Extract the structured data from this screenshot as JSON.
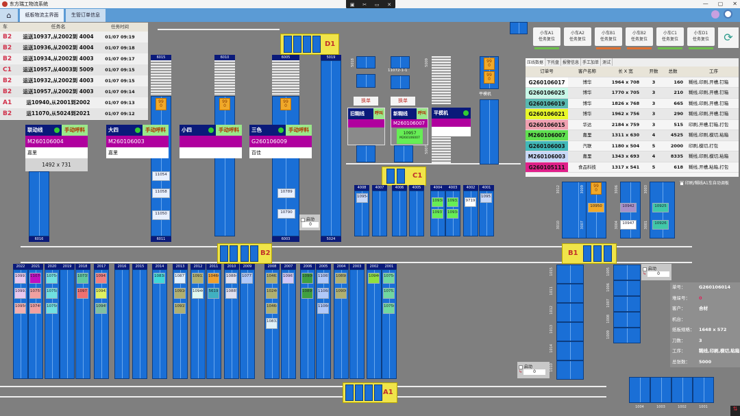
{
  "window": {
    "title": "东方瑞工物流系统",
    "controls": [
      "—",
      "▢",
      "✕"
    ]
  },
  "capture_bar": [
    "▣",
    "✂",
    "▭",
    "✕"
  ],
  "tabs": [
    {
      "label": "⌂"
    },
    {
      "label": "纸板物流主界面"
    },
    {
      "label": "生管订单信息"
    }
  ],
  "tasks": {
    "headers": [
      "车",
      "任务名",
      "任务时间"
    ],
    "rows": [
      {
        "car": "B2",
        "name": "运送10937,从2002到 4004",
        "time": "01/07 09:19"
      },
      {
        "car": "B2",
        "name": "运送10936,从2002到 4004",
        "time": "01/07 09:18"
      },
      {
        "car": "B2",
        "name": "运送10934,从2002到 4003",
        "time": "01/07 09:17"
      },
      {
        "car": "C1",
        "name": "运送10957,从4003到 5009",
        "time": "01/07 09:15"
      },
      {
        "car": "B2",
        "name": "运送10932,从2002到 4003",
        "time": "01/07 09:15"
      },
      {
        "car": "B2",
        "name": "运送10957,从2002到 4003",
        "time": "01/07 09:14"
      },
      {
        "car": "A1",
        "name": "运10940,从2001到2002",
        "time": "01/07 09:13"
      },
      {
        "car": "B2",
        "name": "运11070,从5024到2021",
        "time": "01/07 09:12"
      }
    ]
  },
  "stations": [
    {
      "name": "联动线",
      "call": "手动呼料",
      "order": "M260106004",
      "customer": "嘉里",
      "size": "1492 x 731"
    },
    {
      "name": "大四",
      "call": "手动呼料",
      "order": "M260106003",
      "customer": "嘉里",
      "size": ""
    },
    {
      "name": "小四",
      "call": "手动呼料",
      "order": "",
      "customer": "",
      "size": ""
    },
    {
      "name": "三色",
      "call": "手动呼料",
      "order": "G260106009",
      "customer": "百佳",
      "size": ""
    }
  ],
  "glue": [
    {
      "swap": "换单",
      "name": "旧糊线",
      "call": "呼叫",
      "order": ""
    },
    {
      "swap": "换单",
      "name": "新糊线",
      "call": "呼叫",
      "order": "M260106007",
      "pallet": "10957",
      "pallet_order": "M260106007"
    },
    {
      "name": "平模机",
      "order": ""
    }
  ],
  "cranes": {
    "D1": "D1",
    "C1": "C1",
    "B2": "B2",
    "B1": "B1",
    "A1": "A1"
  },
  "top_columns": [
    "6016",
    "6015",
    "6011",
    "6010",
    "6005",
    "6003",
    "5019",
    "5024",
    "5018",
    "11072-1-1",
    "5009",
    "5007",
    "平模机"
  ],
  "orange_pallet": {
    "top": "99",
    "bottom": "0"
  },
  "top_pallets": [
    "11054",
    "11058",
    "11050",
    "10789",
    "10790",
    "10950",
    "10942",
    "10947",
    "10925",
    "10926"
  ],
  "c1_lanes": [
    "4008",
    "4007",
    "4006",
    "4005",
    "4004",
    "4003",
    "4002",
    "4001"
  ],
  "c1_pallets": [
    "10954",
    "10938",
    "10932",
    "10937",
    "10934",
    "9719",
    "10951"
  ],
  "right_lanes": [
    "3012",
    "3010",
    "3009",
    "3007",
    "3006",
    "3004",
    "3003",
    "3001"
  ],
  "auto_top": {
    "label": "启动",
    "value": "0"
  },
  "auto_b1": {
    "label": "启动",
    "value": "0"
  },
  "auto_a1": {
    "label": "启动",
    "value": "0"
  },
  "print_auto": "印刷/糊线A1车自动调板",
  "bottom_lanes": [
    "2022",
    "2021",
    "2020",
    "2019",
    "2018",
    "2017",
    "2016",
    "2015",
    "2014",
    "2013",
    "2012",
    "2011",
    "2010",
    "2009",
    "2008",
    "2007",
    "2006",
    "2005",
    "2004",
    "2003",
    "2002",
    "2001"
  ],
  "bottom_pallets": [
    {
      "lane": 0,
      "id": "10993",
      "color": "#e8c8f0"
    },
    {
      "lane": 0,
      "id": "10992",
      "color": "#e8c8f0"
    },
    {
      "lane": 0,
      "id": "10956",
      "color": "#f4b0b0"
    },
    {
      "lane": 1,
      "id": "11070",
      "color": "#c010c0"
    },
    {
      "lane": 1,
      "id": "10755",
      "color": "#f0a0a0"
    },
    {
      "lane": 1,
      "id": "10749",
      "color": "#f0a0a0"
    },
    {
      "lane": 2,
      "id": "10754",
      "color": "#70e0e0"
    },
    {
      "lane": 2,
      "id": "10758",
      "color": "#70e0e0"
    },
    {
      "lane": 2,
      "id": "10756",
      "color": "#70e0e0"
    },
    {
      "lane": 4,
      "id": "10735",
      "color": "#60c8a0"
    },
    {
      "lane": 4,
      "id": "10971",
      "color": "#f07070"
    },
    {
      "lane": 5,
      "id": "10941",
      "color": "#f08080"
    },
    {
      "lane": 5,
      "id": "10943",
      "color": "#e0f060"
    },
    {
      "lane": 5,
      "id": "10945",
      "color": "#80c0a0"
    },
    {
      "lane": 8,
      "id": "10838",
      "color": "#40d8d8"
    },
    {
      "lane": 9,
      "id": "10877",
      "color": "#e0f0ff"
    },
    {
      "lane": 9,
      "id": "10916",
      "color": "#b0b070"
    },
    {
      "lane": 9,
      "id": "10915",
      "color": "#b0b070"
    },
    {
      "lane": 10,
      "id": "10913",
      "color": "#b0b070"
    },
    {
      "lane": 10,
      "id": "10946",
      "color": "#e0f8f0"
    },
    {
      "lane": 11,
      "id": "10466",
      "color": "#f0a030"
    },
    {
      "lane": 11,
      "id": "5619",
      "color": "#40b0c0"
    },
    {
      "lane": 12,
      "id": "10884",
      "color": "#e0e0f0"
    },
    {
      "lane": 12,
      "id": "10885",
      "color": "#e0e0f0"
    },
    {
      "lane": 13,
      "id": "10771",
      "color": "#b0c8f8"
    },
    {
      "lane": 14,
      "id": "10463",
      "color": "#b0b070"
    },
    {
      "lane": 14,
      "id": "10240",
      "color": "#b0b070"
    },
    {
      "lane": 14,
      "id": "10464",
      "color": "#b0b070"
    },
    {
      "lane": 14,
      "id": "10832",
      "color": "#e0f0f8"
    },
    {
      "lane": 15,
      "id": "10967",
      "color": "#d0c8f8"
    },
    {
      "lane": 16,
      "id": "10906",
      "color": "#40a040"
    },
    {
      "lane": 16,
      "id": "10895",
      "color": "#40a040"
    },
    {
      "lane": 17,
      "id": "11065",
      "color": "#b0c8f8"
    },
    {
      "lane": 17,
      "id": "11068",
      "color": "#b0c8f8"
    },
    {
      "lane": 17,
      "id": "11066",
      "color": "#b0c8f8"
    },
    {
      "lane": 18,
      "id": "10898",
      "color": "#b0b070"
    },
    {
      "lane": 18,
      "id": "10900",
      "color": "#b0b070"
    },
    {
      "lane": 20,
      "id": "10940",
      "color": "#90e040"
    },
    {
      "lane": 21,
      "id": "10754",
      "color": "#70d8a0"
    },
    {
      "lane": 21,
      "id": "10752",
      "color": "#70d8a0"
    },
    {
      "lane": 21,
      "id": "10756",
      "color": "#70d8a0"
    }
  ],
  "b1_lanes": [
    "1015",
    "1011",
    "1012",
    "1013",
    "1014",
    "1010"
  ],
  "b1_right_lanes": [
    "1005",
    "1006",
    "1007",
    "1008",
    "1009"
  ],
  "a1_lanes": [
    "1004",
    "1003",
    "1002",
    "1001"
  ],
  "cars": [
    {
      "name": "小车A1",
      "action": "任务复位",
      "status": "#6cc04a"
    },
    {
      "name": "小车A2",
      "action": "任务复位",
      "status": ""
    },
    {
      "name": "小车B1",
      "action": "任务复位",
      "status": "#e07030"
    },
    {
      "name": "小车B2",
      "action": "任务复位",
      "status": "#e07030"
    },
    {
      "name": "小车C1",
      "action": "任务复位",
      "status": "#6cc04a"
    },
    {
      "name": "小车D1",
      "action": "任务复位",
      "status": "#6cc04a"
    }
  ],
  "order_tabs": [
    "压线数据",
    "下托盘",
    "报警信息",
    "手工加单",
    "测试"
  ],
  "orders": {
    "headers": [
      "订单号",
      "客户名称",
      "长 X 宽",
      "开数",
      "总数",
      "工序"
    ],
    "rows": [
      {
        "id": "G260106017",
        "customer": "博华",
        "size": "1964 x 708",
        "cut": "3",
        "total": "160",
        "process": "糊线,印刷,开槽,钉箱",
        "color": "#ffffff"
      },
      {
        "id": "G260106025",
        "customer": "博华",
        "size": "1770 x 705",
        "cut": "3",
        "total": "210",
        "process": "糊线,印刷,开槽,钉箱",
        "color": "#c8f8e8"
      },
      {
        "id": "G260106019",
        "customer": "博华",
        "size": "1826 x 768",
        "cut": "3",
        "total": "665",
        "process": "糊线,印刷,开槽,钉箱",
        "color": "#58b8b0"
      },
      {
        "id": "G260106021",
        "customer": "博华",
        "size": "1962 x 756",
        "cut": "3",
        "total": "290",
        "process": "糊线,印刷,开槽,钉箱",
        "color": "#e8f828"
      },
      {
        "id": "G260106015",
        "customer": "华达",
        "size": "2184 x 759",
        "cut": "3",
        "total": "515",
        "process": "印刷,开槽,钉箱,打包",
        "color": "#f0a0b0"
      },
      {
        "id": "M260106007",
        "customer": "嘉里",
        "size": "1311 x 630",
        "cut": "4",
        "total": "4525",
        "process": "糊线,印刷,模切,粘箱",
        "color": "#60e050"
      },
      {
        "id": "G260106003",
        "customer": "汽联",
        "size": "1180 x 504",
        "cut": "5",
        "total": "2000",
        "process": "印刷,模切,打包",
        "color": "#40b8b8"
      },
      {
        "id": "M260106003",
        "customer": "嘉里",
        "size": "1343 x 693",
        "cut": "4",
        "total": "8335",
        "process": "糊线,印刷,模切,粘箱",
        "color": "#c8d8f8"
      },
      {
        "id": "G260105111",
        "customer": "食品科技",
        "size": "1317 x 541",
        "cut": "5",
        "total": "618",
        "process": "糊线,开槽,粘箱,打包",
        "color": "#e0208a"
      }
    ]
  },
  "info": [
    {
      "k": "单号：",
      "v": "G260106014"
    },
    {
      "k": "堆垛号：",
      "v": "0",
      "red": true
    },
    {
      "k": "客户：",
      "v": "合材"
    },
    {
      "k": "机台：",
      "v": ""
    },
    {
      "k": "纸板规格：",
      "v": "1648 x 572"
    },
    {
      "k": "刀数：",
      "v": "3"
    },
    {
      "k": "工序：",
      "v": "糊线,印刷,模切,粘箱"
    },
    {
      "k": "总张数：",
      "v": "5000"
    }
  ]
}
